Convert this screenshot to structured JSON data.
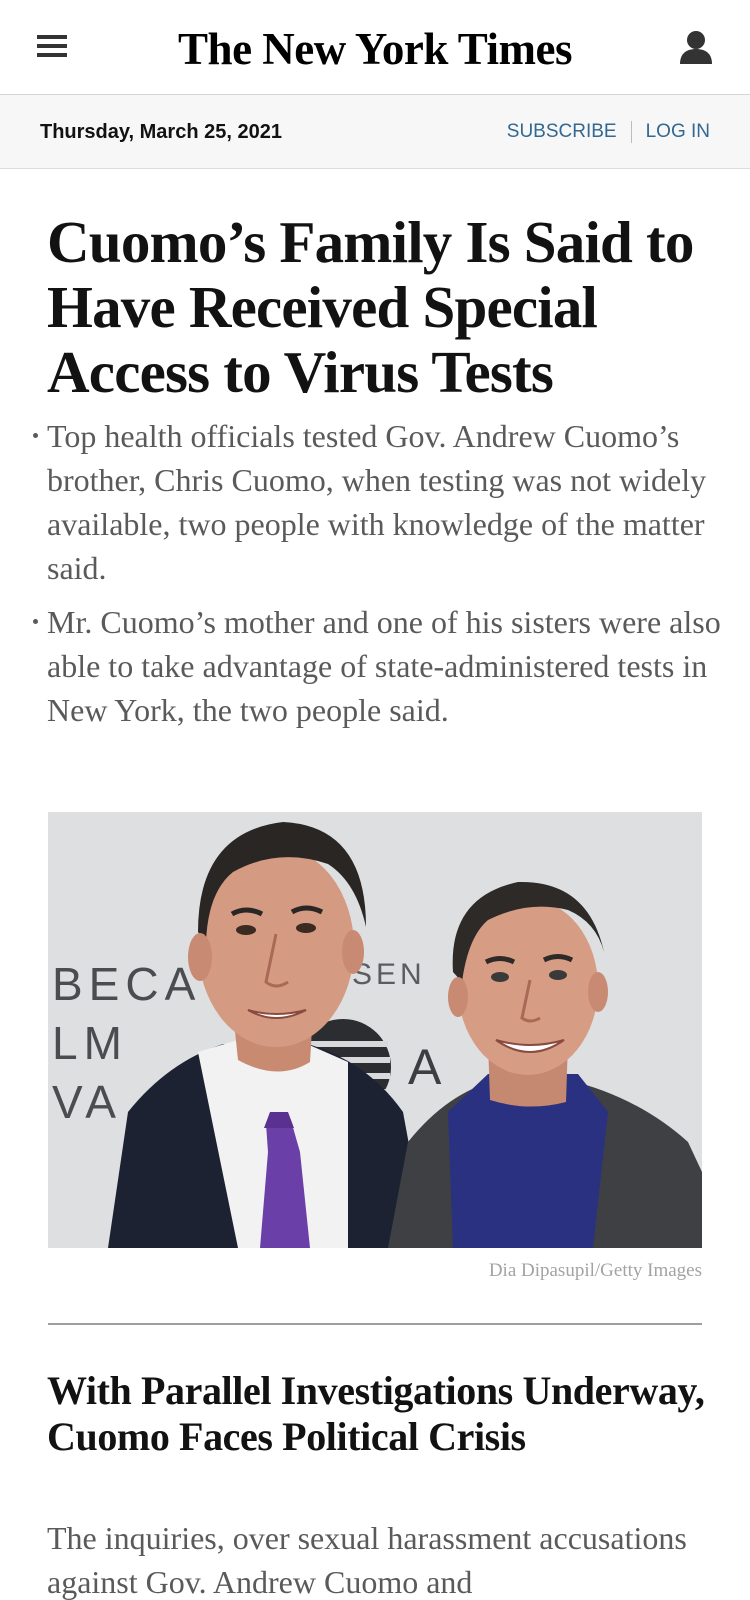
{
  "header": {
    "menu_icon": "hamburger-menu-icon",
    "logo_text": "The New York Times",
    "account_icon": "person-account-icon"
  },
  "subbar": {
    "date": "Thursday, March 25, 2021",
    "subscribe_label": "SUBSCRIBE",
    "login_label": "LOG IN"
  },
  "lead_story": {
    "headline": "Cuomo’s Family Is Said to Have Received Special Access to Virus Tests",
    "summary": [
      "Top health officials tested Gov. Andrew Cuomo’s brother, Chris Cuomo, when testing was not widely available, two people with knowledge of the matter said.",
      "Mr. Cuomo’s mother and one of his sisters were also able to take advantage of state-administered tests in New York, the two people said."
    ],
    "photo_backdrop_text": {
      "left_letters": [
        "BECA",
        "LM",
        "VA"
      ],
      "right_letters": "SEN",
      "partial_letter": "A"
    },
    "photo_credit": "Dia Dipasupil/Getty Images"
  },
  "second_story": {
    "headline": "With Parallel Investigations Underway, Cuomo Faces Political Crisis",
    "summary": "The inquiries, over sexual harassment accusations against Gov. Andrew Cuomo and"
  },
  "colors": {
    "link_blue": "#326891",
    "subbar_background": "#f7f7f7",
    "summary_gray": "#5a5a5a",
    "credit_gray": "#a3a3a3",
    "headline_black": "#121212"
  }
}
